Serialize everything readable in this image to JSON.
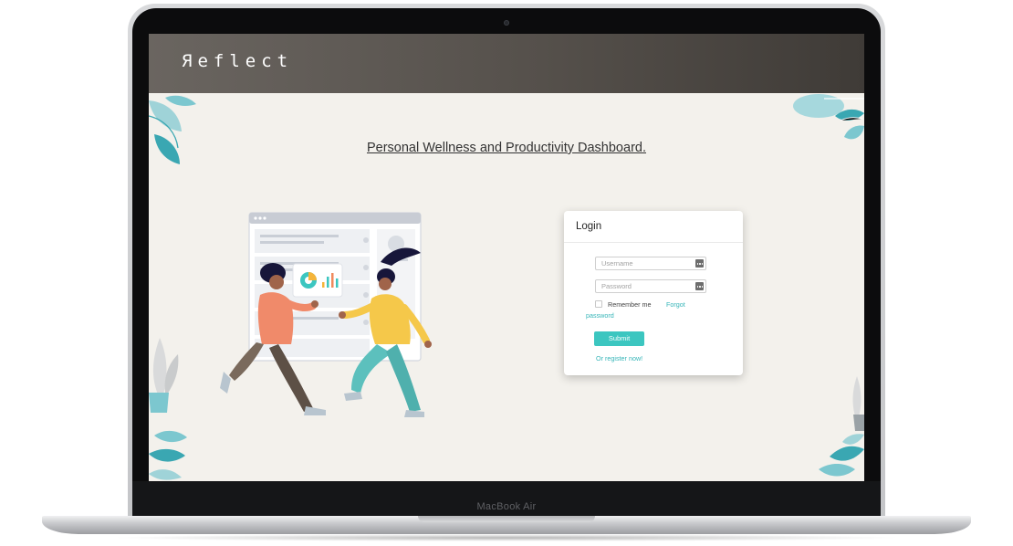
{
  "app": {
    "logo_text": "Яeflect",
    "page_title": "Personal Wellness and Productivity Dashboard."
  },
  "login": {
    "title": "Login",
    "username_placeholder": "Username",
    "password_placeholder": "Password",
    "remember_label": "Remember me",
    "forgot_line1": "Forgot",
    "forgot_line2": "password",
    "submit_label": "Submit",
    "register_link": "Or register now!"
  },
  "device": {
    "label": "MacBook Air"
  },
  "colors": {
    "accent": "#3cc6c0",
    "topbar": "#55504b",
    "background": "#f3f1ec",
    "leaf": "#5fb8c0"
  },
  "icons": [
    "key-icon",
    "leaf-decoration",
    "people-illustration"
  ]
}
